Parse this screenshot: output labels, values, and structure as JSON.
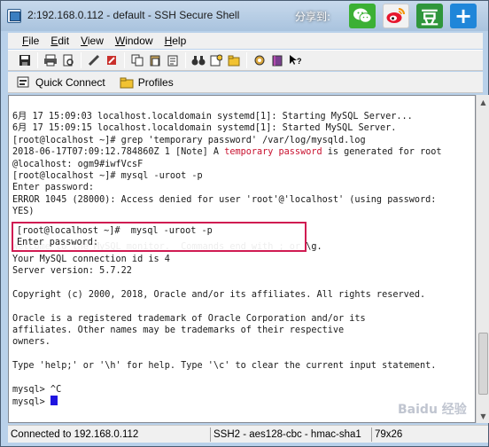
{
  "window": {
    "title": "2:192.168.0.112 - default - SSH Secure Shell"
  },
  "share": {
    "label": "分享到:",
    "douban_glyph": "豆",
    "more_glyph": "+"
  },
  "menu": [
    {
      "u": "F",
      "rest": "ile"
    },
    {
      "u": "E",
      "rest": "dit"
    },
    {
      "u": "V",
      "rest": "iew"
    },
    {
      "u": "W",
      "rest": "indow"
    },
    {
      "u": "H",
      "rest": "elp"
    }
  ],
  "toolbar_icons": [
    "save-icon",
    "print-icon",
    "print-preview-icon",
    "find-icon",
    "settings-icon",
    "copy-icon",
    "paste-icon",
    "paste-special-icon",
    "binoculars-icon",
    "new-profile-icon",
    "folder-transfer-icon",
    "gear-icon",
    "book-icon",
    "help-pointer-icon"
  ],
  "connectbar": {
    "quick_connect": "Quick Connect",
    "profiles": "Profiles"
  },
  "terminal": {
    "lines_before": [
      "6月 17 15:09:03 localhost.localdomain systemd[1]: Starting MySQL Server...",
      "6月 17 15:09:15 localhost.localdomain systemd[1]: Started MySQL Server.",
      "[root@localhost ~]# grep 'temporary password' /var/log/mysqld.log"
    ],
    "log_line": {
      "pre": "2018-06-17T07:09:12.784860Z 1 [Note] A ",
      "highlight": "temporary password",
      "post": " is generated for root"
    },
    "lines_after_log": [
      "@localhost: ogm9#iwfVcsF",
      "[root@localhost ~]# mysql -uroot -p",
      "Enter password:",
      "ERROR 1045 (28000): Access denied for user 'root'@'localhost' (using password:",
      "YES)"
    ],
    "boxed_lines": [
      "[root@localhost ~]#  mysql -uroot -p",
      "Enter password:"
    ],
    "lines_tail": [
      "Welcome to the MySQL monitor.  Commands end with ; or \\g.",
      "Your MySQL connection id is 4",
      "Server version: 5.7.22",
      "",
      "Copyright (c) 2000, 2018, Oracle and/or its affiliates. All rights reserved.",
      "",
      "Oracle is a registered trademark of Oracle Corporation and/or its",
      "affiliates. Other names may be trademarks of their respective",
      "owners.",
      "",
      "Type 'help;' or '\\h' for help. Type '\\c' to clear the current input statement.",
      "",
      "mysql> ^C"
    ],
    "prompt": "mysql> "
  },
  "status": {
    "connection": "Connected to 192.168.0.112",
    "cipher": "SSH2 - aes128-cbc - hmac-sha1",
    "size": "79x26"
  },
  "watermark": "Baidu 经验"
}
